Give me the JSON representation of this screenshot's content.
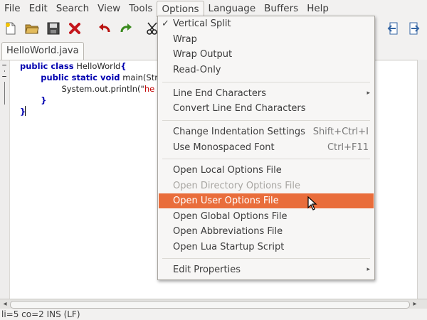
{
  "menubar": {
    "items": [
      "File",
      "Edit",
      "Search",
      "View",
      "Tools",
      "Options",
      "Language",
      "Buffers",
      "Help"
    ]
  },
  "toolbar": {
    "buttons": [
      {
        "icon": "new-file-icon"
      },
      {
        "icon": "open-folder-icon"
      },
      {
        "icon": "save-icon"
      },
      {
        "icon": "close-icon"
      },
      {
        "icon": "undo-icon"
      },
      {
        "icon": "redo-icon"
      },
      {
        "icon": "cut-icon"
      },
      {
        "icon": "previous-buffer-icon"
      },
      {
        "icon": "next-buffer-icon"
      }
    ]
  },
  "tab": {
    "label": "HelloWorld.java"
  },
  "editor": {
    "lines": [
      {
        "kw": "public class",
        "rest": " HelloWorld",
        "brace": "{"
      },
      {
        "indent": "        ",
        "kw": "public static void",
        "rest": " main(Str"
      },
      {
        "indent": "                ",
        "plain": "System.out.println(\"",
        "str": "he"
      },
      {
        "indent": "        ",
        "brace": "}"
      },
      {
        "brace": "}"
      }
    ]
  },
  "status": {
    "text": "li=5 co=2 INS (LF)"
  },
  "options_menu": {
    "group1": [
      {
        "label": "Vertical Split",
        "checked": true
      },
      {
        "label": "Wrap"
      },
      {
        "label": "Wrap Output"
      },
      {
        "label": "Read-Only"
      }
    ],
    "group2": [
      {
        "label": "Line End Characters",
        "submenu": true
      },
      {
        "label": "Convert Line End Characters"
      }
    ],
    "group3": [
      {
        "label": "Change Indentation Settings",
        "accel": "Shift+Ctrl+I"
      },
      {
        "label": "Use Monospaced Font",
        "accel": "Ctrl+F11"
      }
    ],
    "group4": [
      {
        "label": "Open Local Options File"
      },
      {
        "label": "Open Directory Options File",
        "disabled": true
      },
      {
        "label": "Open User Options File",
        "highlighted": true
      },
      {
        "label": "Open Global Options File"
      },
      {
        "label": "Open Abbreviations File"
      },
      {
        "label": "Open Lua Startup Script"
      }
    ],
    "group5": [
      {
        "label": "Edit Properties",
        "submenu": true
      }
    ],
    "check_glyph": "✓",
    "submenu_glyph": "▸"
  },
  "colors": {
    "highlight": "#e96d3b",
    "keyword": "#0000b0",
    "string": "#c00000"
  }
}
